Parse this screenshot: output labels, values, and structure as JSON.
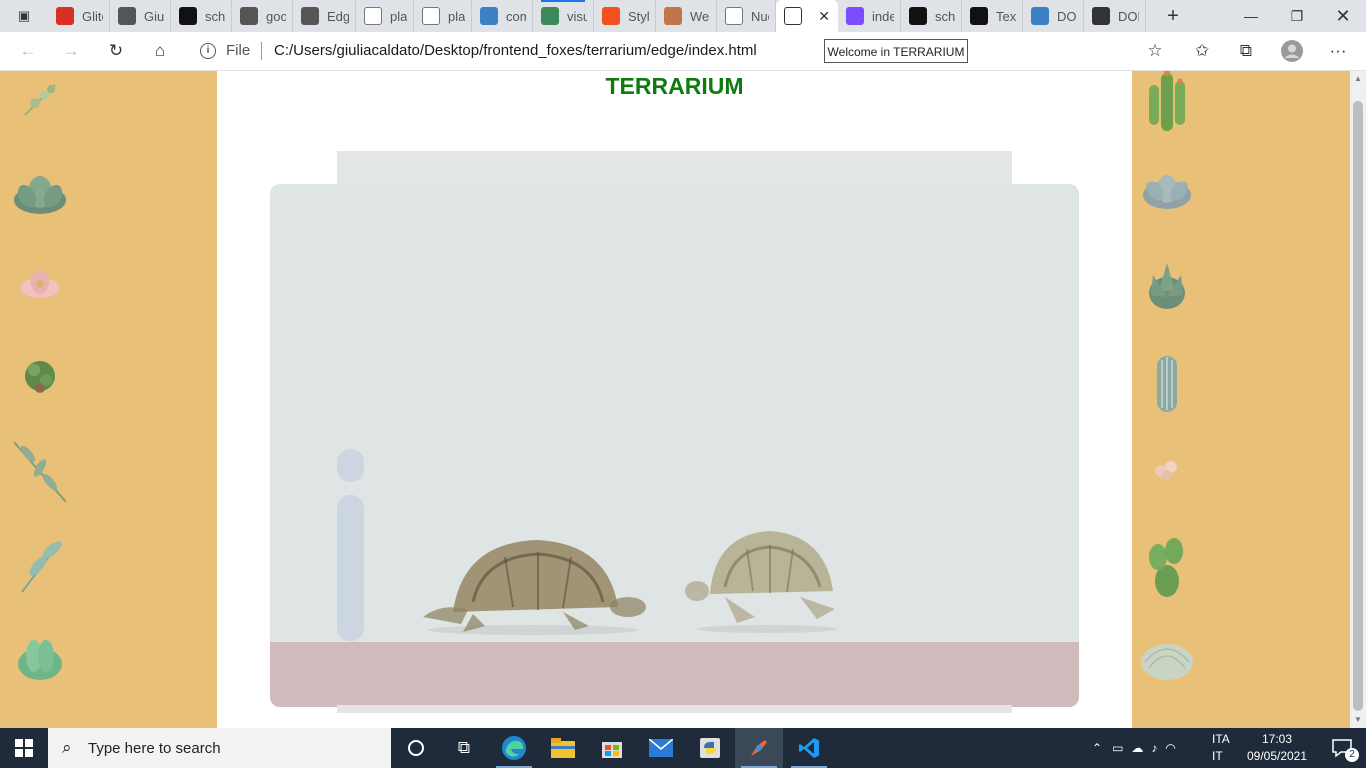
{
  "browser": {
    "tabs": [
      {
        "label": "Glitc",
        "icon": "gmail-icon",
        "color": "#d93025"
      },
      {
        "label": "Giuli",
        "icon": "github-icon",
        "color": "#555555"
      },
      {
        "label": "scho",
        "icon": "github-icon",
        "color": "#111111"
      },
      {
        "label": "goo",
        "icon": "github-icon",
        "color": "#555555"
      },
      {
        "label": "Edge",
        "icon": "github-icon",
        "color": "#555555"
      },
      {
        "label": "plan",
        "icon": "page-icon",
        "color": "#777777"
      },
      {
        "label": "plan",
        "icon": "page-icon",
        "color": "#777777"
      },
      {
        "label": "com",
        "icon": "bing-icon",
        "color": "#3b82c4"
      },
      {
        "label": "visua",
        "icon": "book-icon",
        "color": "#3c8a5a"
      },
      {
        "label": "Style",
        "icon": "windows-color-icon",
        "color": "#f25022"
      },
      {
        "label": "Web",
        "icon": "edge-m-icon",
        "color": "#c0764a"
      },
      {
        "label": "Nuo",
        "icon": "new-tab-icon",
        "color": "#777777"
      },
      {
        "label": "",
        "icon": "page-icon",
        "color": "#333333",
        "active": true
      },
      {
        "label": "inde",
        "icon": "stripe-icon",
        "color": "#7c4dff"
      },
      {
        "label": "scho",
        "icon": "github-icon",
        "color": "#111111"
      },
      {
        "label": "Text",
        "icon": "dev-icon",
        "color": "#111111"
      },
      {
        "label": "DOM",
        "icon": "bing-icon",
        "color": "#3b82c4"
      },
      {
        "label": "DOM",
        "icon": "wrench-icon",
        "color": "#333333"
      }
    ],
    "address": {
      "protocol": "File",
      "url": "C:/Users/giuliacaldato/Desktop/frontend_foxes/terrarium/edge/index.html"
    },
    "tooltip": "Welcome in TERRARIUM"
  },
  "page": {
    "title": "TERRARIUM",
    "colors": {
      "side": "#e8c077",
      "title": "#0e7a10",
      "jar": "#dfe4e4",
      "dirt": "#d1babb"
    }
  },
  "taskbar": {
    "search_placeholder": "Type here to search",
    "lang_line1": "ITA",
    "lang_line2": "IT",
    "time": "17:03",
    "date": "09/05/2021",
    "notifications": "2"
  }
}
